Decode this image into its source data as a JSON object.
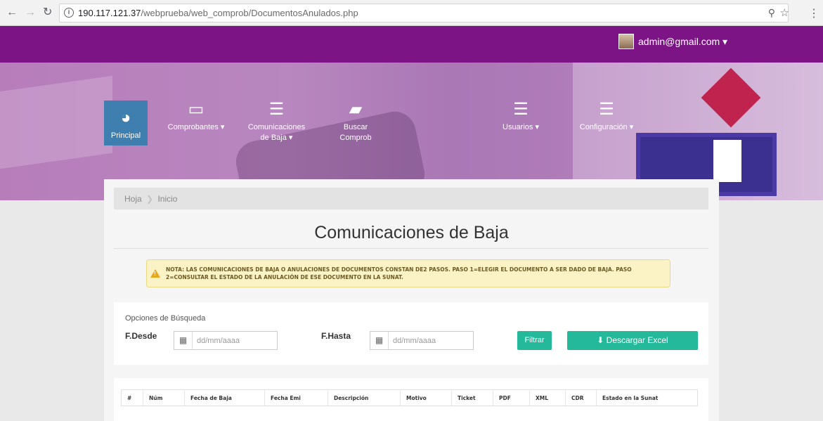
{
  "browser": {
    "url_host": "190.117.121.37",
    "url_path": "/webprueba/web_comprob/DocumentosAnulados.php",
    "icons": [
      "back-arrow-icon",
      "forward-arrow-icon",
      "reload-icon",
      "info-icon",
      "zoom-icon",
      "star-icon",
      "kebab-menu-icon"
    ]
  },
  "header": {
    "user_email": "admin@gmail.com ▾",
    "accent_color": "#7d1486"
  },
  "nav": {
    "principal": "Principal",
    "comprobantes": "Comprobantes ▾",
    "baja_line1": "Comunicaciones",
    "baja_line2": "de Baja ▾",
    "buscar_line1": "Buscar",
    "buscar_line2": "Comprob",
    "usuarios": "Usuarios ▾",
    "configuracion": "Configuración ▾",
    "active_color": "#3e7fb0"
  },
  "breadcrumb": {
    "root": "Hoja",
    "current": "Inicio"
  },
  "page": {
    "title": "Comunicaciones de Baja"
  },
  "warning": {
    "text": "NOTA: LAS COMUNICACIONES DE BAJA O ANULACIONES DE DOCUMENTOS CONSTAN DE2 PASOS. PASO 1=ELEGIR EL DOCUMENTO A SER DADO DE BAJA. PASO 2=CONSULTAR EL ESTADO DE LA ANULACIÓN DE ESE DOCUMENTO EN LA SUNAT."
  },
  "search": {
    "title": "Opciones de Búsqueda",
    "desde_label": "F.Desde",
    "hasta_label": "F.Hasta",
    "desde_placeholder": "dd/mm/aaaa",
    "hasta_placeholder": "dd/mm/aaaa",
    "filtrar_label": "Filtrar",
    "excel_label": "⬇ Descargar Excel",
    "button_color": "#24b99a"
  },
  "table": {
    "columns": [
      "#",
      "Núm",
      "Fecha de Baja",
      "Fecha Emi",
      "Descripción",
      "Motivo",
      "Ticket",
      "PDF",
      "XML",
      "CDR",
      "Estado en la Sunat"
    ]
  }
}
